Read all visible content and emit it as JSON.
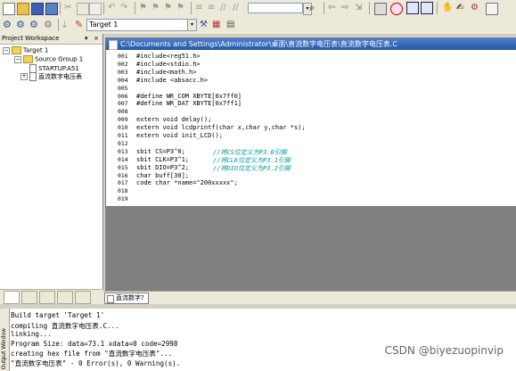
{
  "toolbar": {
    "target_value": "Target 1",
    "find_value": ""
  },
  "workspace": {
    "title": "Project Workspace",
    "tree": [
      "Target 1",
      "Source Group 1",
      "STARTUP.A51",
      "直流数字电压表"
    ]
  },
  "editor": {
    "title": "C:\\Documents and Settings\\Administrator\\桌面\\直流数字电压表\\直流数字电压表.C",
    "line_numbers": [
      "001",
      "002",
      "003",
      "004",
      "005",
      "006",
      "007",
      "008",
      "009",
      "010",
      "011",
      "012",
      "013",
      "014",
      "015",
      "016",
      "017",
      "018",
      "019"
    ],
    "lines": [
      "#include<reg51.h>",
      "#include<stdio.h>",
      "#include<math.h>",
      "#include <absacc.h>",
      "",
      "#define WR_COM XBYTE[0x7ff0]",
      "#define WR_DAT XBYTE[0x7ff1]",
      "",
      "extern void delay();",
      "extern void lcdprintf(char x,char y,char *s);",
      "extern void init_LCD();",
      "",
      "sbit CS=P3^0;",
      "sbit CLK=P3^1;",
      "sbit DIO=P3^2;",
      "char buff[30];",
      "code char *name=\"200xxxxx\";",
      "",
      ""
    ],
    "comments": {
      "line13": "//将CS位定义为P3.0引脚",
      "line14": "//将CLK位定义为P3.1引脚",
      "line15": "//将DIO位定义为P3.2引脚"
    },
    "tab_label": "直流数字?"
  },
  "output": {
    "side_label": "Output Window",
    "lines": [
      "Build target 'Target 1'",
      "compiling 直流数字电压表.C...",
      "linking...",
      "Program Size: data=73.1 xdata=0 code=2998",
      "creating hex file from \"直流数字电压表\"...",
      "\"直流数字电压表\" - 0 Error(s), 0 Warning(s)."
    ]
  },
  "watermark": "CSDN @biyezuopinvip"
}
